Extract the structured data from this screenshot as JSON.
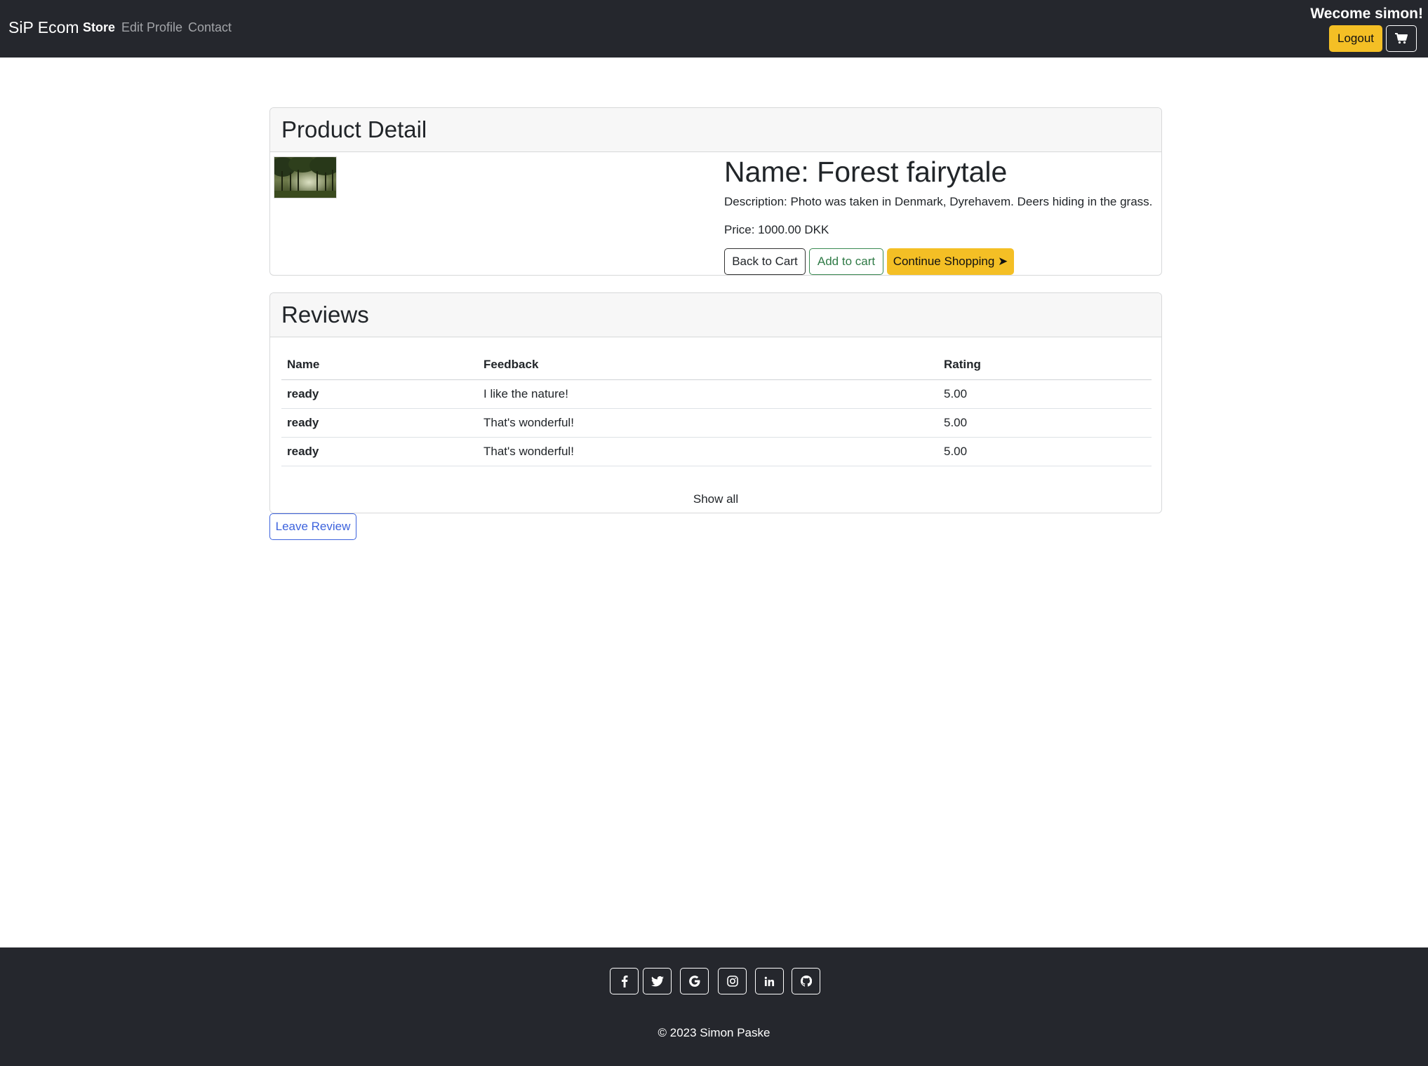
{
  "navbar": {
    "brand": "SiP Ecom",
    "links": [
      {
        "label": "Store"
      },
      {
        "label": "Edit Profile"
      },
      {
        "label": "Contact"
      }
    ],
    "welcome": "Wecome simon!",
    "logout_label": "Logout",
    "cart_icon": "shopping-cart-icon"
  },
  "product": {
    "header": "Product Detail",
    "name": "Name: Forest fairytale",
    "description": "Description: Photo was taken in Denmark, Dyrehavem. Deers hiding in the grass.",
    "price": "Price: 1000.00 DKK",
    "buttons": {
      "back": "Back to Cart",
      "add": "Add to cart",
      "continue": "Continue Shopping ➤"
    }
  },
  "reviews": {
    "header": "Reviews",
    "columns": [
      "Name",
      "Feedback",
      "Rating"
    ],
    "rows": [
      {
        "name": "ready",
        "feedback": "I like the nature!",
        "rating": "5.00"
      },
      {
        "name": "ready",
        "feedback": "That's wonderful!",
        "rating": "5.00"
      },
      {
        "name": "ready",
        "feedback": "That's wonderful!",
        "rating": "5.00"
      }
    ],
    "show_all": "Show all",
    "leave_review": "Leave Review"
  },
  "footer": {
    "social": [
      "facebook-icon",
      "twitter-icon",
      "google-icon",
      "instagram-icon",
      "linkedin-icon",
      "github-icon"
    ],
    "copyright": "© 2023 Simon Paske"
  },
  "colors": {
    "navbar_bg": "#25272d",
    "accent_yellow": "#f4bf25",
    "success_green": "#2f7a46",
    "primary_blue": "#3d63dd"
  }
}
